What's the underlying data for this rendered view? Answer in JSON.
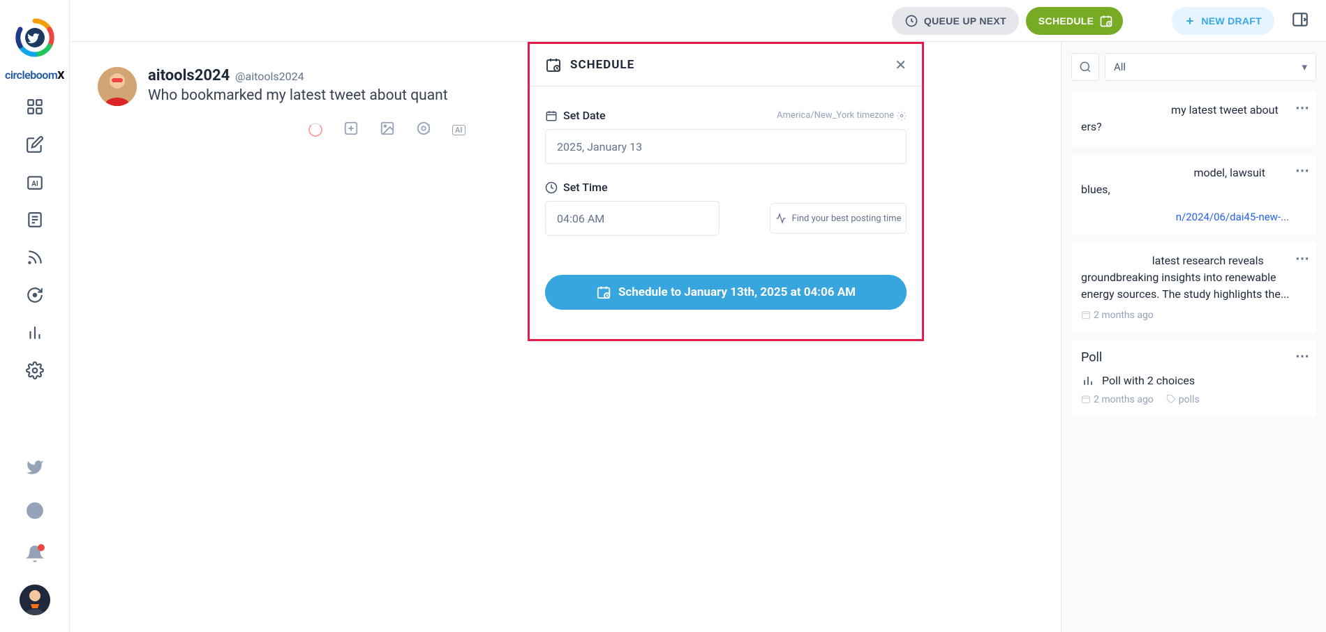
{
  "brand": {
    "name": "circleboom",
    "suffix": "X"
  },
  "topbar": {
    "queue_label": "QUEUE UP NEXT",
    "schedule_label": "SCHEDULE",
    "new_draft_label": "NEW DRAFT"
  },
  "composer": {
    "display_name": "aitools2024",
    "handle": "@aitools2024",
    "text": "Who bookmarked my latest tweet about quant"
  },
  "schedule_popup": {
    "title": "SCHEDULE",
    "set_date_label": "Set Date",
    "timezone": "America/New_York timezone",
    "date_value": "2025, January 13",
    "set_time_label": "Set Time",
    "time_value": "04:06 AM",
    "best_time_label": "Find your best posting time",
    "submit_label": "Schedule to January 13th, 2025 at 04:06 AM"
  },
  "right_panel": {
    "filter_value": "All",
    "drafts": [
      {
        "text_fragment": "my latest tweet about ers?"
      },
      {
        "text_fragment": "model, lawsuit blues,",
        "link_fragment": "n/2024/06/dai45-new-..."
      },
      {
        "text_fragment": "latest research reveals groundbreaking insights into renewable energy sources. The study highlights the...",
        "timestamp": "2 months ago"
      },
      {
        "title": "Poll",
        "poll_text": "Poll with 2 choices",
        "timestamp": "2 months ago",
        "tag": "polls"
      }
    ]
  }
}
